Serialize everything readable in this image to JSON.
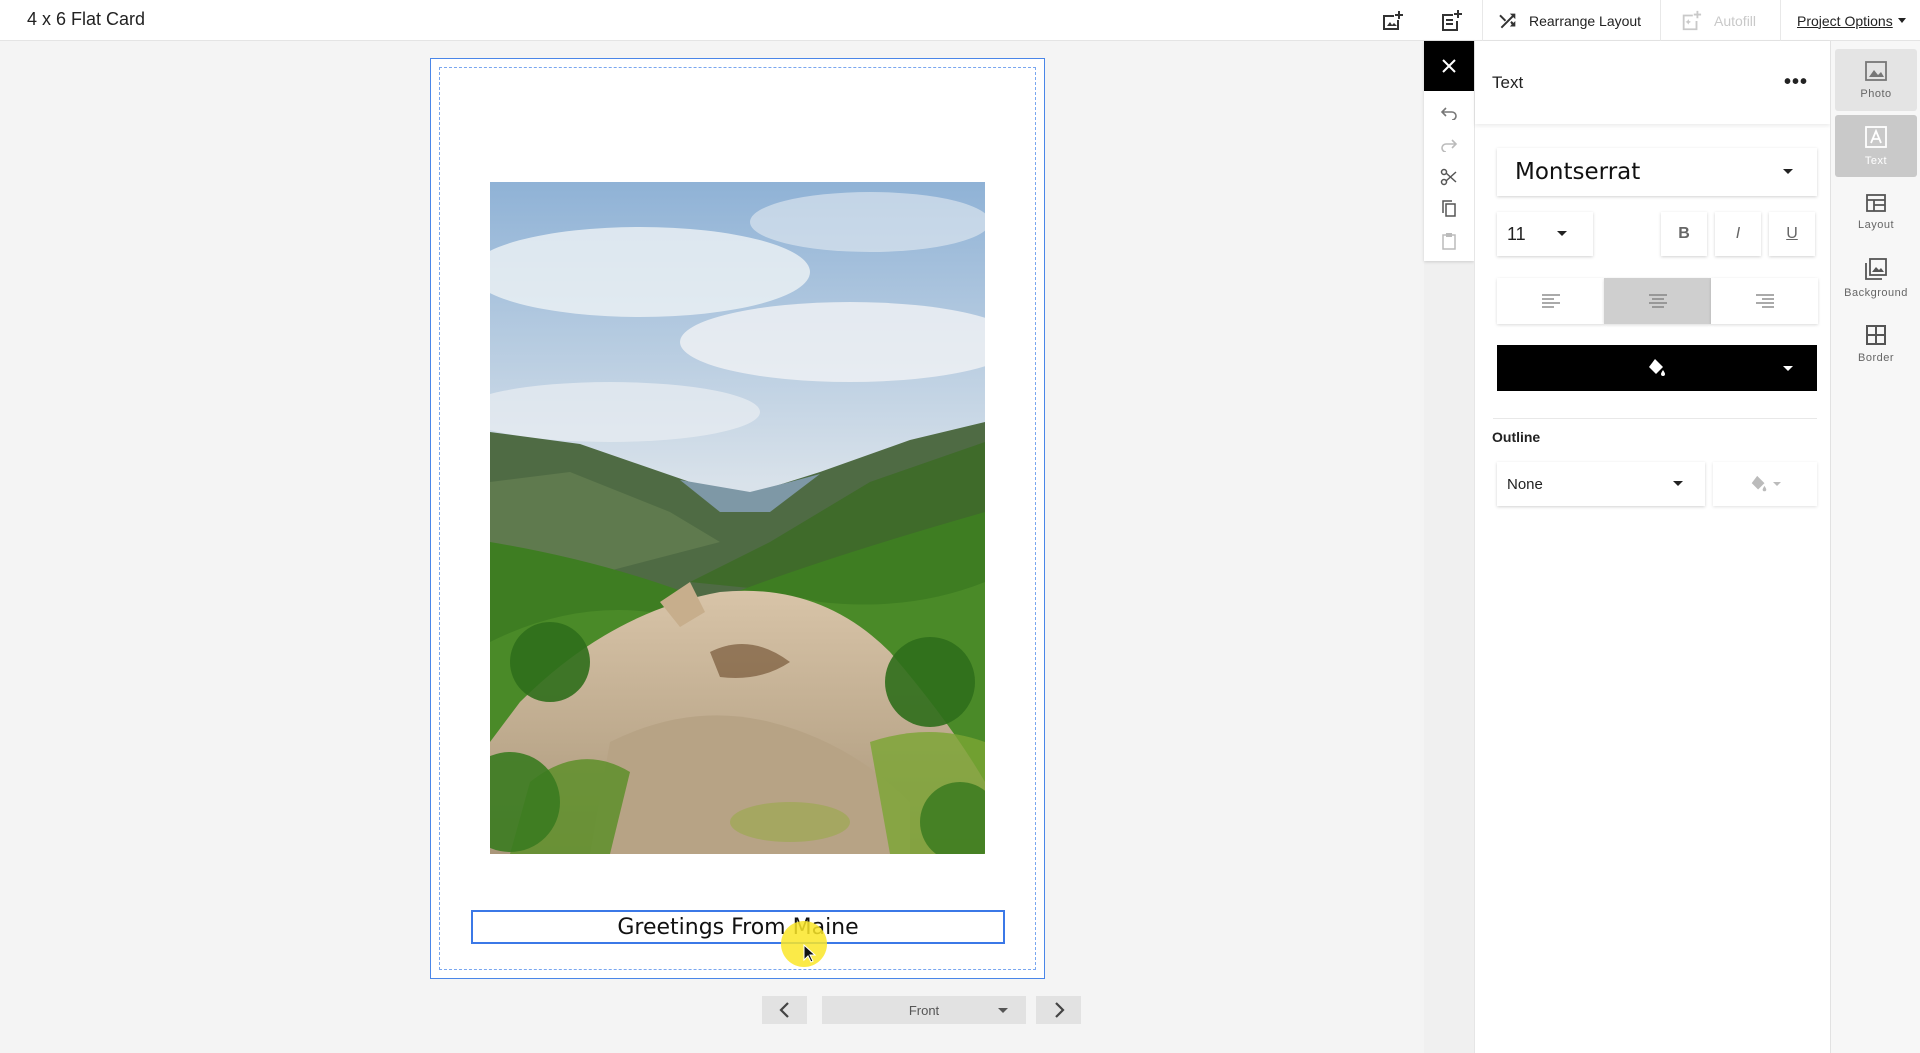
{
  "app": {
    "title": "4 x 6 Flat Card"
  },
  "toolbar": {
    "rearrange_label": "Rearrange Layout",
    "autofill_label": "Autofill",
    "project_options_label": "Project Options"
  },
  "card": {
    "text_content": "Greetings From Maine"
  },
  "pager": {
    "current": "Front"
  },
  "panel": {
    "title": "Text",
    "font": "Montserrat",
    "size": "11",
    "bold": "B",
    "italic": "I",
    "underline": "U",
    "outline_label": "Outline",
    "outline_value": "None",
    "text_color": "#000000",
    "alignment": "center"
  },
  "rail": {
    "items": [
      {
        "label": "Photo"
      },
      {
        "label": "Text"
      },
      {
        "label": "Layout"
      },
      {
        "label": "Background"
      },
      {
        "label": "Border"
      }
    ]
  }
}
